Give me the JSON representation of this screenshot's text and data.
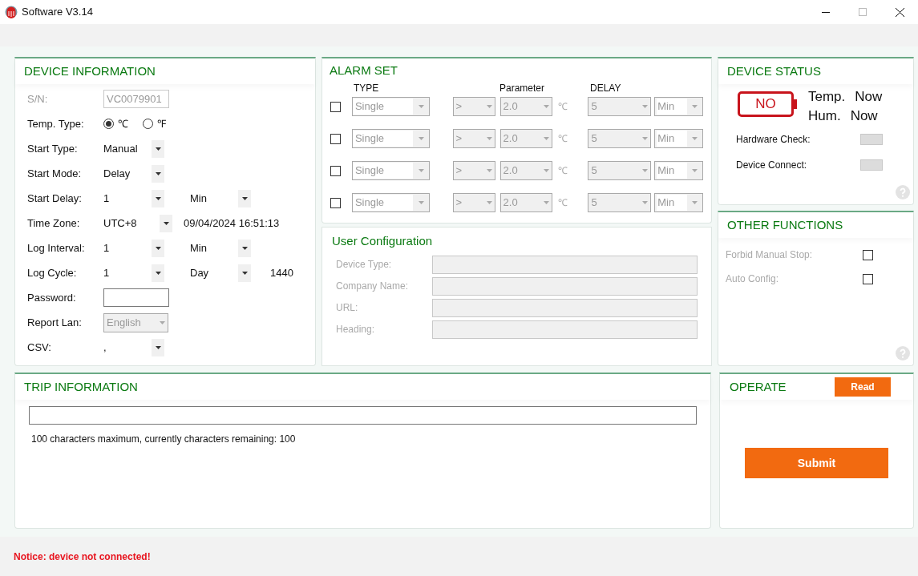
{
  "window": {
    "title": "Software V3.14"
  },
  "device_information": {
    "title": "DEVICE INFORMATION",
    "rows": [
      {
        "kind": "field",
        "label": "S/N:",
        "value": "VC0079901",
        "disabled": true
      },
      {
        "kind": "radio",
        "label": "Temp. Type:",
        "options": [
          {
            "label": "℃",
            "selected": true
          },
          {
            "label": "℉",
            "selected": false
          }
        ]
      },
      {
        "kind": "selects",
        "label": "Start Type:",
        "selects": [
          "Manual"
        ]
      },
      {
        "kind": "selects",
        "label": "Start Mode:",
        "selects": [
          "Delay"
        ]
      },
      {
        "kind": "selects",
        "label": "Start Delay:",
        "selects": [
          "1",
          "Min"
        ]
      },
      {
        "kind": "selects",
        "label": "Time Zone:",
        "selects": [
          "UTC+8"
        ],
        "extra": "09/04/2024 16:51:13"
      },
      {
        "kind": "selects",
        "label": "Log Interval:",
        "selects": [
          "1",
          "Min"
        ]
      },
      {
        "kind": "selects",
        "label": "Log Cycle:",
        "selects": [
          "1",
          "Day"
        ],
        "extra": "1440"
      },
      {
        "kind": "field",
        "label": "Password:",
        "disabled": false
      },
      {
        "kind": "disabled_select",
        "label": "Report Lan:",
        "value": "English"
      },
      {
        "kind": "selects",
        "label": "CSV:",
        "selects": [
          ","
        ]
      }
    ]
  },
  "alarm_set": {
    "title": "ALARM SET",
    "headers": [
      "TYPE",
      "Parameter",
      "DELAY"
    ],
    "rows": [
      {
        "checked": false,
        "type": "Single",
        "operator": ">",
        "parameter": "2.0",
        "unit": "℃",
        "delay": "5",
        "delay_unit": "Min"
      },
      {
        "checked": false,
        "type": "Single",
        "operator": ">",
        "parameter": "2.0",
        "unit": "℃",
        "delay": "5",
        "delay_unit": "Min"
      },
      {
        "checked": false,
        "type": "Single",
        "operator": ">",
        "parameter": "2.0",
        "unit": "℃",
        "delay": "5",
        "delay_unit": "Min"
      },
      {
        "checked": false,
        "type": "Single",
        "operator": ">",
        "parameter": "2.0",
        "unit": "℃",
        "delay": "5",
        "delay_unit": "Min"
      }
    ]
  },
  "user_configuration": {
    "title": "User Configuration",
    "fields": [
      {
        "label": "Device Type:"
      },
      {
        "label": "Company Name:"
      },
      {
        "label": "URL:"
      },
      {
        "label": "Heading:"
      }
    ]
  },
  "device_status": {
    "title": "DEVICE STATUS",
    "battery": "NO",
    "readings": [
      {
        "label": "Temp.",
        "value": "Now"
      },
      {
        "label": "Hum.",
        "value": "Now"
      }
    ],
    "checks": [
      {
        "label": "Hardware Check:"
      },
      {
        "label": "Device Connect:"
      }
    ]
  },
  "other_functions": {
    "title": "OTHER FUNCTIONS",
    "options": [
      {
        "label": "Forbid Manual Stop:",
        "checked": false
      },
      {
        "label": "Auto Config:",
        "checked": false
      }
    ]
  },
  "trip_information": {
    "title": "TRIP INFORMATION",
    "note": "100 characters maximum, currently characters remaining: 100"
  },
  "operate": {
    "title": "OPERATE",
    "read_button": "Read",
    "submit_button": "Submit"
  },
  "status_bar": {
    "notice": "Notice: device not connected!"
  }
}
